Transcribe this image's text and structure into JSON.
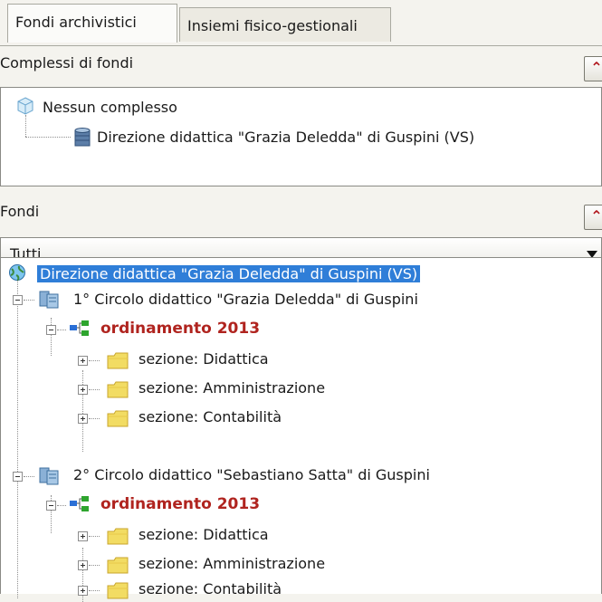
{
  "tabs": [
    "Fondi archivistici",
    "Insiemi fisico-gestionali"
  ],
  "complessi": {
    "label": "Complessi di fondi",
    "tree": [
      "Nessun complesso",
      "Direzione didattica \"Grazia Deledda\" di Guspini (VS)"
    ]
  },
  "fondi": {
    "label": "Fondi",
    "filter_value": "Tutti",
    "tree": {
      "root": "Direzione didattica \"Grazia Deledda\" di Guspini (VS)",
      "children": [
        {
          "label": "1° Circolo didattico \"Grazia Deledda\" di Guspini",
          "ordinamento": "ordinamento 2013",
          "sezioni": [
            "sezione: Didattica",
            "sezione: Amministrazione",
            "sezione: Contabilità"
          ]
        },
        {
          "label": "2° Circolo didattico \"Sebastiano Satta\" di Guspini",
          "ordinamento": "ordinamento 2013",
          "sezioni": [
            "sezione: Didattica",
            "sezione: Amministrazione",
            "sezione: Contabilità"
          ]
        }
      ]
    }
  }
}
